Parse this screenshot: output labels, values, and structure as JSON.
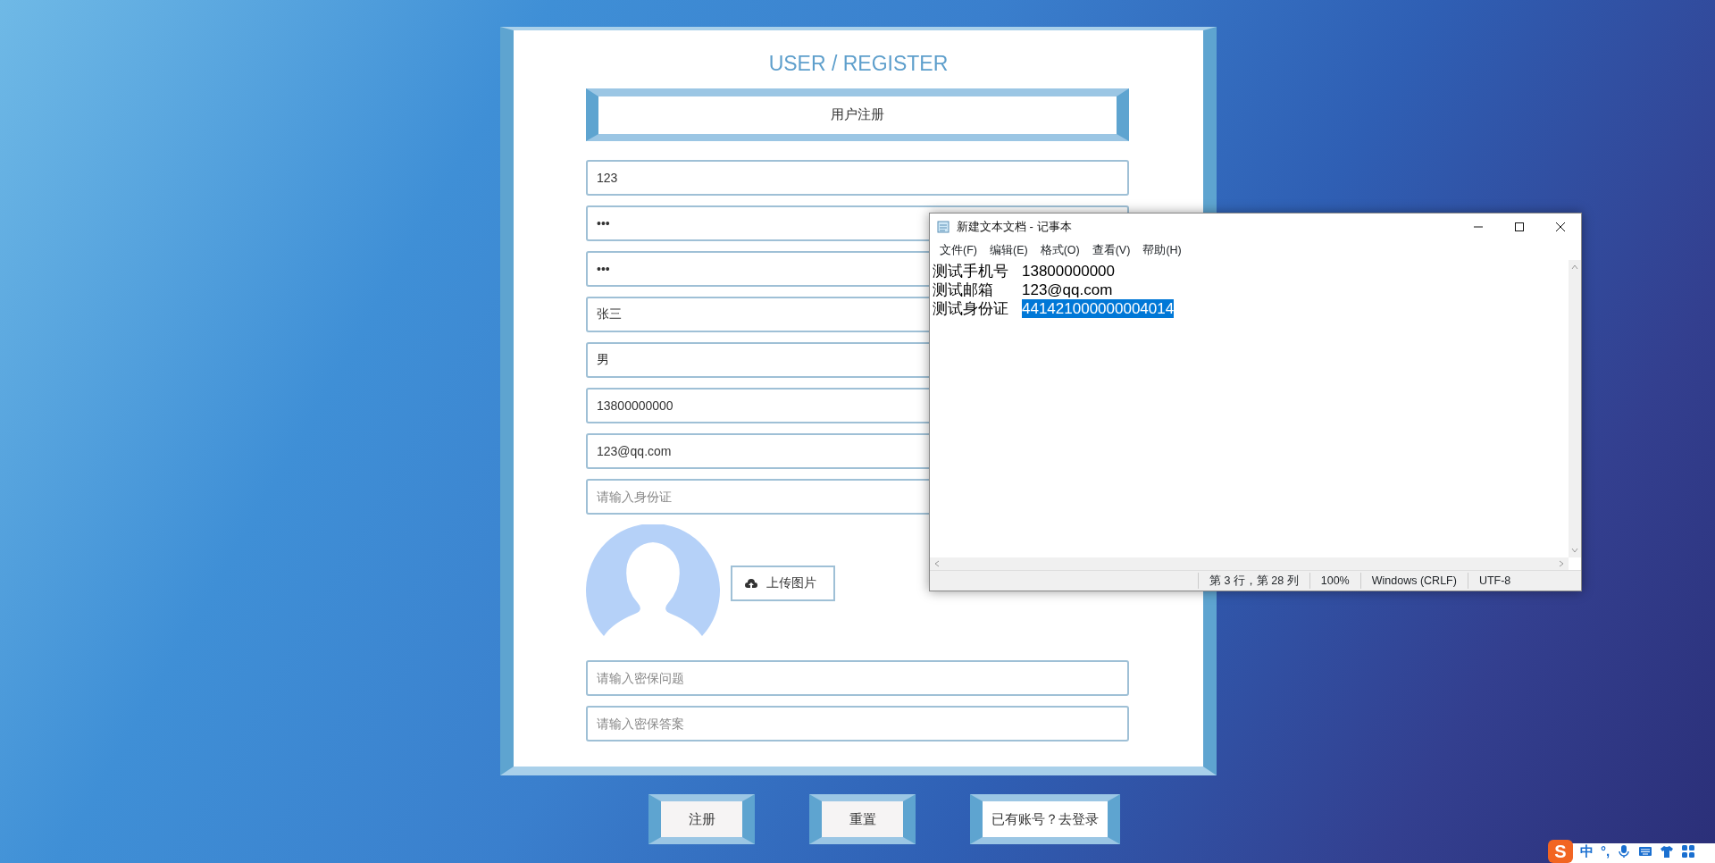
{
  "form": {
    "title": "USER / REGISTER",
    "heading": "用户注册",
    "fields": [
      {
        "kind": "text",
        "value": "123"
      },
      {
        "kind": "text",
        "value": "•••"
      },
      {
        "kind": "text",
        "value": "•••"
      },
      {
        "kind": "text",
        "value": "张三"
      },
      {
        "kind": "text",
        "value": "男"
      },
      {
        "kind": "text",
        "value": "13800000000"
      },
      {
        "kind": "text",
        "value": "123@qq.com"
      },
      {
        "kind": "text",
        "placeholder": "请输入身份证"
      }
    ],
    "upload_button": "上传图片",
    "security_fields": [
      {
        "placeholder": "请输入密保问题"
      },
      {
        "placeholder": "请输入密保答案"
      }
    ]
  },
  "buttons": [
    {
      "label": "注册"
    },
    {
      "label": "重置"
    },
    {
      "label": "已有账号？去登录"
    }
  ],
  "notepad": {
    "title": "新建文本文档 - 记事本",
    "menu": [
      "文件(F)",
      "编辑(E)",
      "格式(O)",
      "查看(V)",
      "帮助(H)"
    ],
    "lines": [
      {
        "label": "测试手机号",
        "value": "13800000000",
        "selected": false
      },
      {
        "label": "测试邮箱",
        "value": "123@qq.com",
        "selected": false
      },
      {
        "label": "测试身份证",
        "value": "441421000000004014",
        "selected": true
      }
    ],
    "status_bar": [
      "第 3 行，第 28 列",
      "100%",
      "Windows (CRLF)",
      "UTF-8"
    ]
  },
  "ime_toolbar": {
    "logo": "S",
    "items": [
      "中",
      "°,"
    ]
  }
}
